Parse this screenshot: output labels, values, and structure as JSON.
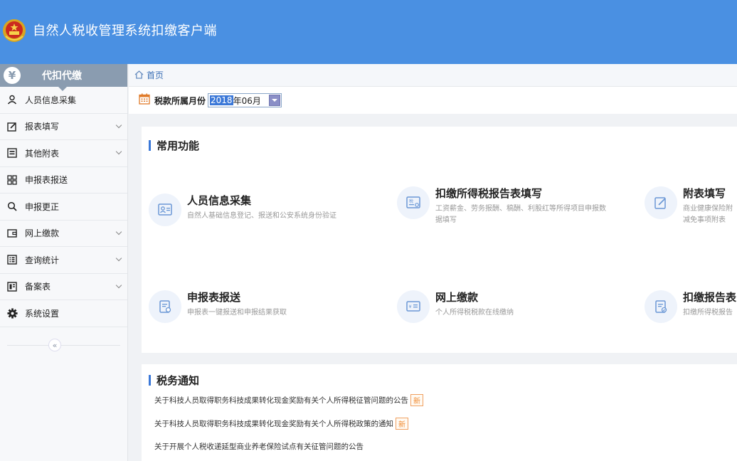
{
  "app": {
    "title": "自然人税收管理系统扣缴客户端"
  },
  "sidebar": {
    "header_icon": "¥",
    "header_title": "代扣代缴",
    "items": [
      {
        "label": "人员信息采集",
        "icon": "person-icon",
        "expandable": false
      },
      {
        "label": "报表填写",
        "icon": "edit-icon",
        "expandable": true
      },
      {
        "label": "其他附表",
        "icon": "form-icon",
        "expandable": true
      },
      {
        "label": "申报表报送",
        "icon": "grid-icon",
        "expandable": false
      },
      {
        "label": "申报更正",
        "icon": "search-icon",
        "expandable": false
      },
      {
        "label": "网上缴款",
        "icon": "wallet-icon",
        "expandable": true
      },
      {
        "label": "查询统计",
        "icon": "list-icon",
        "expandable": true
      },
      {
        "label": "备案表",
        "icon": "book-icon",
        "expandable": true
      },
      {
        "label": "系统设置",
        "icon": "gear-icon",
        "expandable": false
      }
    ],
    "collapse_glyph": "«"
  },
  "breadcrumb": {
    "home": "首页"
  },
  "filter": {
    "label": "税款所属月份",
    "year": "2018",
    "rest": "年06月"
  },
  "common": {
    "title": "常用功能",
    "cards": [
      {
        "title": "人员信息采集",
        "desc": [
          "自然人基础信息登记、报送和公安系统身份验证"
        ],
        "icon": "id-card-icon"
      },
      {
        "title": "扣缴所得税报告表填写",
        "desc": [
          "工资薪金、劳务报酬、稿酬、利股红等所得项目申报数",
          "据填写"
        ],
        "icon": "tax-form-icon"
      },
      {
        "title": "附表填写",
        "desc": [
          "商业健康保险附",
          "减免事项附表"
        ],
        "icon": "pen-doc-icon"
      },
      {
        "title": "申报表报送",
        "desc": [
          "申报表一键报送和申报结果获取"
        ],
        "icon": "report-send-icon"
      },
      {
        "title": "网上缴款",
        "desc": [
          "个人所得税税款在线缴纳"
        ],
        "icon": "payment-icon"
      },
      {
        "title": "扣缴报告表",
        "desc": [
          "扣缴所得税报告"
        ],
        "icon": "report-check-icon"
      }
    ]
  },
  "notices": {
    "title": "税务通知",
    "new_badge": "新",
    "items": [
      {
        "text": "关于科技人员取得职务科技成果转化现金奖励有关个人所得税征管问题的公告",
        "is_new": true
      },
      {
        "text": "关于科技人员取得职务科技成果转化现金奖励有关个人所得税政策的通知",
        "is_new": true
      },
      {
        "text": "关于开展个人税收递延型商业养老保险试点有关征管问题的公告",
        "is_new": false
      }
    ]
  },
  "colors": {
    "header": "#4a90e2",
    "accent": "#3b78d8",
    "new_badge": "#f08a30"
  }
}
